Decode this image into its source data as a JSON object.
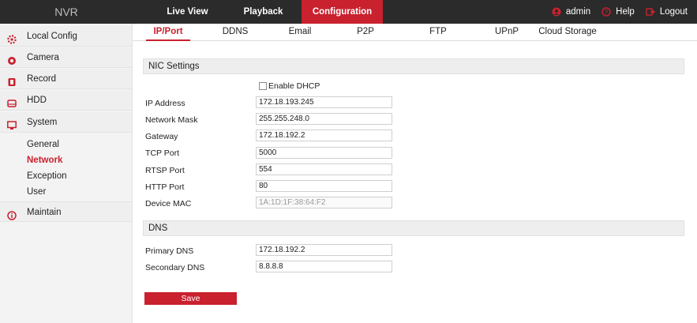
{
  "app": {
    "title": "NVR"
  },
  "topnav": {
    "tabs": [
      {
        "label": "Live View"
      },
      {
        "label": "Playback"
      },
      {
        "label": "Configuration",
        "active": true
      }
    ],
    "right": [
      {
        "label": "admin",
        "icon": "user-icon"
      },
      {
        "label": "Help",
        "icon": "help-icon"
      },
      {
        "label": "Logout",
        "icon": "logout-icon"
      }
    ]
  },
  "sidebar": {
    "items": [
      {
        "label": "Local Config",
        "icon": "gear-icon"
      },
      {
        "label": "Camera",
        "icon": "camera-icon"
      },
      {
        "label": "Record",
        "icon": "record-icon"
      },
      {
        "label": "HDD",
        "icon": "hdd-icon"
      },
      {
        "label": "System",
        "icon": "monitor-icon"
      },
      {
        "label": "Maintain",
        "icon": "info-icon"
      }
    ],
    "system_sub": [
      {
        "label": "General"
      },
      {
        "label": "Network",
        "active": true
      },
      {
        "label": "Exception"
      },
      {
        "label": "User"
      }
    ]
  },
  "subtabs": [
    {
      "label": "IP/Port",
      "active": true
    },
    {
      "label": "DDNS"
    },
    {
      "label": "Email"
    },
    {
      "label": "P2P"
    },
    {
      "label": "FTP"
    },
    {
      "label": "UPnP"
    },
    {
      "label": "Cloud Storage"
    }
  ],
  "nic": {
    "heading": "NIC Settings",
    "dhcp_label": "Enable DHCP",
    "dhcp_checked": false,
    "fields": [
      {
        "label": "IP Address",
        "value": "172.18.193.245"
      },
      {
        "label": "Network Mask",
        "value": "255.255.248.0"
      },
      {
        "label": "Gateway",
        "value": "172.18.192.2"
      },
      {
        "label": "TCP Port",
        "value": "5000"
      },
      {
        "label": "RTSP Port",
        "value": "554"
      },
      {
        "label": "HTTP Port",
        "value": "80"
      },
      {
        "label": "Device MAC",
        "value": "1A:1D:1F:38:64:F2",
        "readonly": true
      }
    ]
  },
  "dns": {
    "heading": "DNS",
    "fields": [
      {
        "label": "Primary DNS",
        "value": "172.18.192.2"
      },
      {
        "label": "Secondary DNS",
        "value": "8.8.8.8"
      }
    ]
  },
  "save_label": "Save",
  "colors": {
    "accent": "#c9212e",
    "topbar": "#2b2b2b",
    "sidebar": "#f3f3f3"
  }
}
